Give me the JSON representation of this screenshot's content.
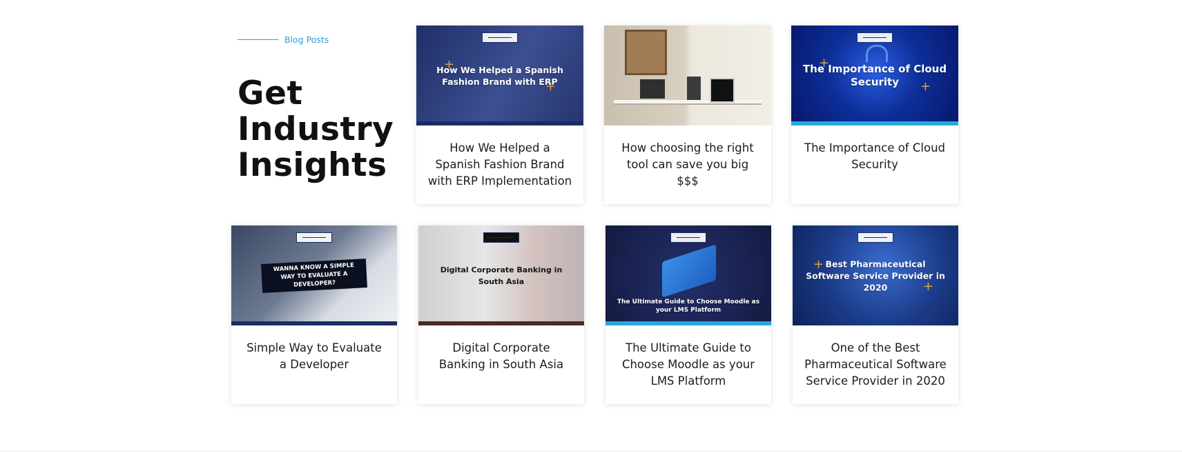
{
  "section": {
    "eyebrow": "Blog Posts",
    "title": "Get Industry Insights",
    "accent_color": "#2a9fd6"
  },
  "posts": [
    {
      "title": "How We Helped a Spanish Fashion Brand with ERP Implementation",
      "thumbnail_caption": "How We Helped a Spanish Fashion Brand with ERP",
      "thumbnail_theme": "#2b3f7e"
    },
    {
      "title": "How choosing the right tool can save you big $$$",
      "thumbnail_caption": "",
      "thumbnail_theme": "#cfc7b7"
    },
    {
      "title": "The Importance of Cloud Security",
      "thumbnail_caption": "The Importance of Cloud Security",
      "thumbnail_theme": "#0a2a8c"
    },
    {
      "title": "Simple Way to Evaluate a Developer",
      "thumbnail_caption": "WANNA KNOW A SIMPLE WAY TO EVALUATE A DEVELOPER?",
      "thumbnail_theme": "#3d4a63"
    },
    {
      "title": "Digital Corporate Banking in South Asia",
      "thumbnail_caption": "Digital Corporate Banking in South Asia",
      "thumbnail_theme": "#c9c9c9"
    },
    {
      "title": "The Ultimate Guide to Choose Moodle as your LMS Platform",
      "thumbnail_caption": "The Ultimate Guide to Choose Moodle as your LMS Platform",
      "thumbnail_theme": "#1b2554"
    },
    {
      "title": "One of the Best Pharmaceutical Software Service Provider in 2020",
      "thumbnail_caption": "Best Pharmaceutical Software Service Provider in 2020",
      "thumbnail_theme": "#1b3a86"
    }
  ]
}
